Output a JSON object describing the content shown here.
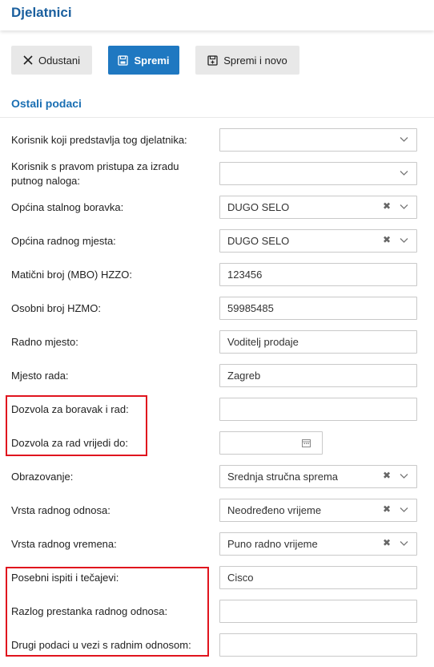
{
  "page": {
    "title": "Djelatnici"
  },
  "toolbar": {
    "cancel_label": "Odustani",
    "save_label": "Spremi",
    "save_new_label": "Spremi i novo"
  },
  "section": {
    "title": "Ostali podaci"
  },
  "fields": {
    "korisnik_djelatnik": {
      "label": "Korisnik koji predstavlja tog djelatnika:",
      "value": ""
    },
    "korisnik_putni": {
      "label": "Korisnik s pravom pristupa za izradu putnog naloga:",
      "value": ""
    },
    "opcina_boravka": {
      "label": "Općina stalnog boravka:",
      "value": "DUGO SELO"
    },
    "opcina_rada": {
      "label": "Općina radnog mjesta:",
      "value": "DUGO SELO"
    },
    "mbo": {
      "label": "Matični broj (MBO) HZZO:",
      "value": "123456"
    },
    "hzmo": {
      "label": "Osobni broj HZMO:",
      "value": "59985485"
    },
    "radno_mjesto": {
      "label": "Radno mjesto:",
      "value": "Voditelj prodaje"
    },
    "mjesto_rada": {
      "label": "Mjesto rada:",
      "value": "Zagreb"
    },
    "dozvola": {
      "label": "Dozvola za boravak i rad:",
      "value": ""
    },
    "dozvola_do": {
      "label": "Dozvola za rad vrijedi do:",
      "value": ""
    },
    "obrazovanje": {
      "label": "Obrazovanje:",
      "value": "Srednja stručna sprema"
    },
    "vrsta_odnosa": {
      "label": "Vrsta radnog odnosa:",
      "value": "Neodređeno vrijeme"
    },
    "vrsta_vremena": {
      "label": "Vrsta radnog vremena:",
      "value": "Puno radno vrijeme"
    },
    "ispiti": {
      "label": "Posebni ispiti i tečajevi:",
      "value": "Cisco"
    },
    "razlog": {
      "label": "Razlog prestanka radnog odnosa:",
      "value": ""
    },
    "drugi": {
      "label": "Drugi podaci u vezi s radnim odnosom:",
      "value": ""
    }
  },
  "icons": {
    "cancel": "close-icon",
    "save": "floppy-disk-icon",
    "save_new": "floppy-disk-plus-icon",
    "dropdown": "chevron-down-icon",
    "clear": "clear-icon",
    "date": "calendar-icon"
  },
  "colors": {
    "accent": "#1f78c1",
    "title": "#1a5f9e",
    "highlight": "#e0141e"
  }
}
